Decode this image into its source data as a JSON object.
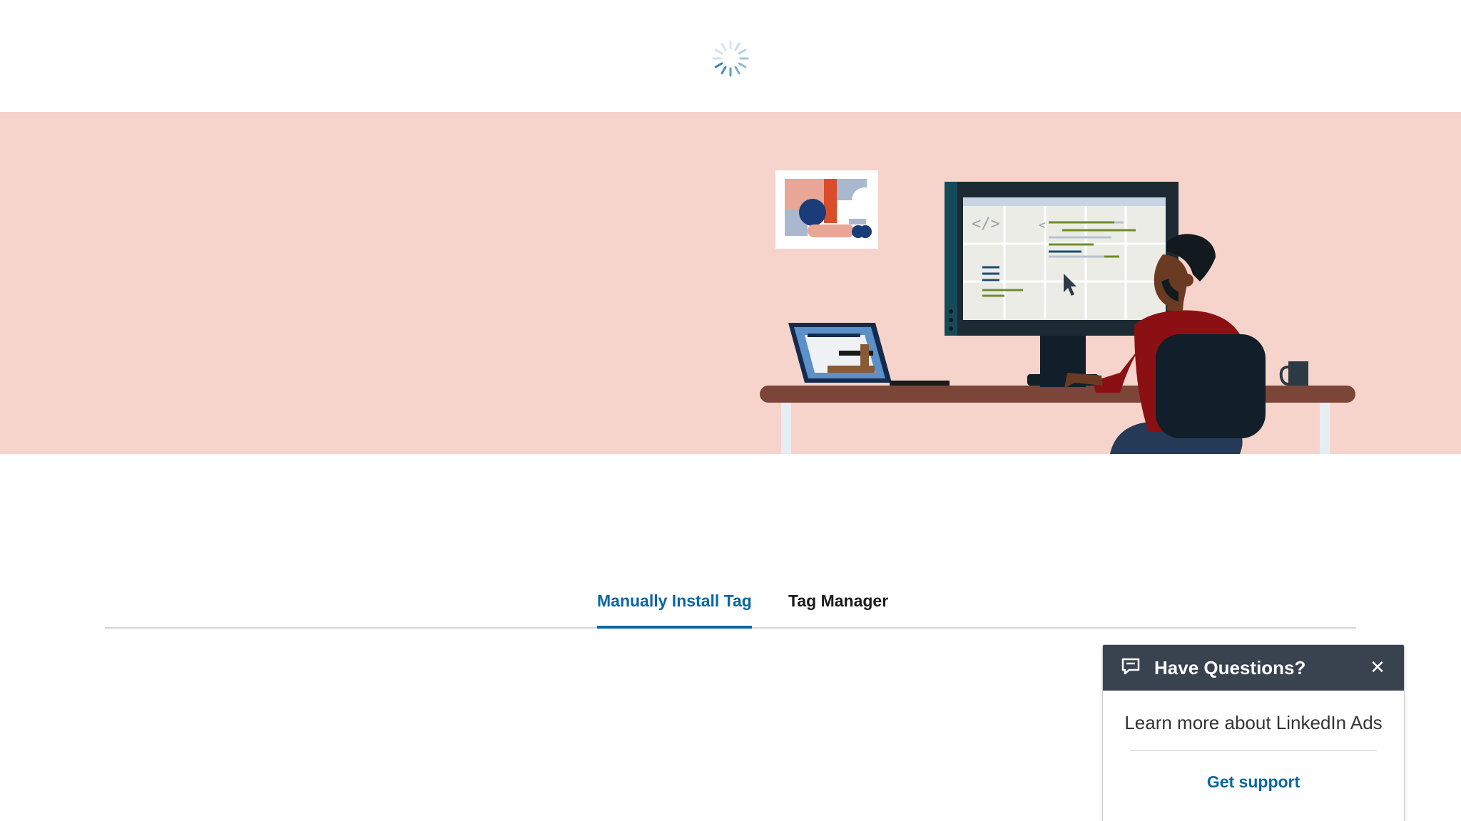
{
  "loader": {
    "icon": "loading-spinner-icon",
    "color": "#0a66a2"
  },
  "hero": {
    "background_color": "#f6d4cb",
    "illustration": "person-at-desk-with-monitor-illustration"
  },
  "tabs": [
    {
      "label": "Manually Install Tag",
      "active": true
    },
    {
      "label": "Tag Manager",
      "active": false
    }
  ],
  "help_widget": {
    "icon": "chat-icon",
    "title": "Have Questions?",
    "close_icon": "close-icon",
    "close_symbol": "✕",
    "body_text": "Learn more about LinkedIn Ads",
    "link_label": "Get support",
    "header_color": "#38434f",
    "link_color": "#0a66a2"
  }
}
